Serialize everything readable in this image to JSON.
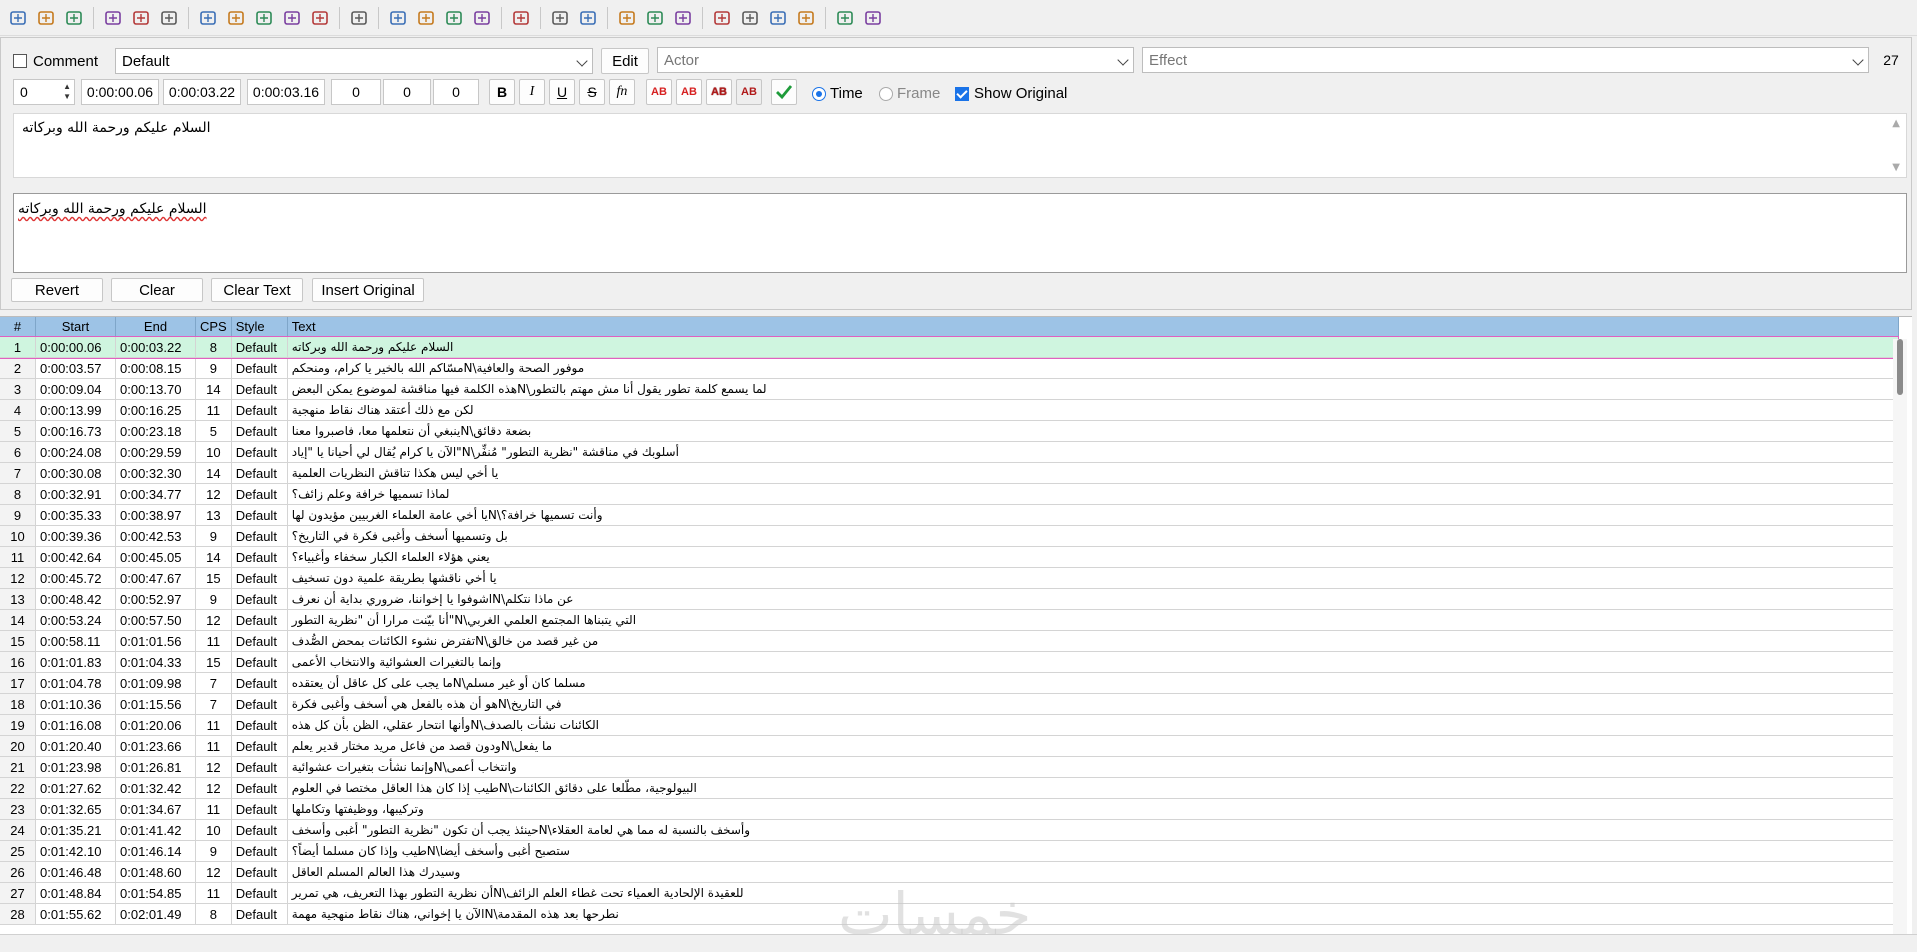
{
  "toolbar": {
    "icons": [
      "new-file-icon",
      "open-folder-icon",
      "save-icon",
      "jump-to-icon",
      "zoom-in-icon",
      "zoom-out-icon",
      "snap-start-icon",
      "snap-end-icon",
      "video-zoom-icon",
      "video-fit-icon",
      "video-full-icon",
      "video-detach-icon",
      "grid-icon",
      "keyframes-icon",
      "styles-manager-icon",
      "attachments-icon",
      "fonts-collector-icon",
      "translation-icon",
      "resample-icon",
      "timing-postprocessor-icon",
      "kanji-timer-icon",
      "shift-times-icon",
      "clock-icon",
      "select-lines-icon",
      "spell-check-icon",
      "automation-icon",
      "tools-icon",
      "options-icon"
    ]
  },
  "edit": {
    "comment_label": "Comment",
    "style_value": "Default",
    "edit_button": "Edit",
    "actor_placeholder": "Actor",
    "effect_placeholder": "Effect",
    "char_count": "27",
    "layer_value": "0",
    "start_time": "0:00:00.06",
    "end_time": "0:00:03.22",
    "duration": "0:00:03.16",
    "margin_l": "0",
    "margin_r": "0",
    "margin_v": "0",
    "bold_label": "B",
    "italic_label": "I",
    "underline_label": "U",
    "strike_label": "S",
    "font_label": "fn",
    "color_labels": [
      "AB",
      "AB",
      "AB",
      "AB"
    ],
    "time_label": "Time",
    "frame_label": "Frame",
    "show_original_label": "Show Original",
    "original_text": "السلام عليكم ورحمة الله وبركاته",
    "edited_text": "السلام عليكم ورحمة الله وبركاته",
    "revert_button": "Revert",
    "clear_button": "Clear",
    "clear_text_button": "Clear Text",
    "insert_original_button": "Insert Original"
  },
  "grid": {
    "headers": [
      "#",
      "Start",
      "End",
      "CPS",
      "Style",
      "Text"
    ],
    "rows": [
      {
        "n": "1",
        "start": "0:00:00.06",
        "end": "0:00:03.22",
        "cps": "8",
        "style": "Default",
        "text": "السلام عليكم ورحمة الله وبركاته"
      },
      {
        "n": "2",
        "start": "0:00:03.57",
        "end": "0:00:08.15",
        "cps": "9",
        "style": "Default",
        "text": "موفور الصحة والعافية\\Nمسّاكم الله بالخير يا كرام، ومنحكم"
      },
      {
        "n": "3",
        "start": "0:00:09.04",
        "end": "0:00:13.70",
        "cps": "14",
        "style": "Default",
        "text": "لما يسمع كلمة تطور يقول أنا مش مهتم بالتطور\\Nهذه الكلمة فيها مناقشة لموضوع يمكن البعض"
      },
      {
        "n": "4",
        "start": "0:00:13.99",
        "end": "0:00:16.25",
        "cps": "11",
        "style": "Default",
        "text": "لكن مع ذلك أعتقد هناك نقاط منهجية"
      },
      {
        "n": "5",
        "start": "0:00:16.73",
        "end": "0:00:23.18",
        "cps": "5",
        "style": "Default",
        "text": "بضعة دقائق\\Nينبغي أن نتعلمها معا، فاصبروا معنا"
      },
      {
        "n": "6",
        "start": "0:00:24.08",
        "end": "0:00:29.59",
        "cps": "10",
        "style": "Default",
        "text": "أسلوبك في مناقشة \"نظرية التطور\" مُنفِّر\\N\"الآن يا كرام يُقال لي أحيانا يا \"إياد"
      },
      {
        "n": "7",
        "start": "0:00:30.08",
        "end": "0:00:32.30",
        "cps": "14",
        "style": "Default",
        "text": "يا أخي ليس هكذا تناقش النظريات العلمية"
      },
      {
        "n": "8",
        "start": "0:00:32.91",
        "end": "0:00:34.77",
        "cps": "12",
        "style": "Default",
        "text": "لماذا تسميها خرافة وعلم زائف؟"
      },
      {
        "n": "9",
        "start": "0:00:35.33",
        "end": "0:00:38.97",
        "cps": "13",
        "style": "Default",
        "text": "وأنت تسميها خرافة؟\\Nيا أخي عامة العلماء الغربيين مؤيدون لها"
      },
      {
        "n": "10",
        "start": "0:00:39.36",
        "end": "0:00:42.53",
        "cps": "9",
        "style": "Default",
        "text": "بل وتسميها أسخف وأغبى فكرة في التاريخ؟"
      },
      {
        "n": "11",
        "start": "0:00:42.64",
        "end": "0:00:45.05",
        "cps": "14",
        "style": "Default",
        "text": "يعني هؤلاء العلماء الكبار سخفاء وأغبياء؟"
      },
      {
        "n": "12",
        "start": "0:00:45.72",
        "end": "0:00:47.67",
        "cps": "15",
        "style": "Default",
        "text": "يا أخي ناقشها بطريقة علمية دون تسخيف"
      },
      {
        "n": "13",
        "start": "0:00:48.42",
        "end": "0:00:52.97",
        "cps": "9",
        "style": "Default",
        "text": "عن ماذا نتكلم\\Nاشوفوا يا إخواننا، ضروري بداية أن نعرف"
      },
      {
        "n": "14",
        "start": "0:00:53.24",
        "end": "0:00:57.50",
        "cps": "12",
        "style": "Default",
        "text": "التي يتبناها المجتمع العلمي الغربي\\N\"أنا بيّنت مرارا أن \"نظرية التطور"
      },
      {
        "n": "15",
        "start": "0:00:58.11",
        "end": "0:01:01.56",
        "cps": "11",
        "style": "Default",
        "text": "من غير قصد من خالق\\Nتفترض نشوء الكائنات بمحض الصُّدف"
      },
      {
        "n": "16",
        "start": "0:01:01.83",
        "end": "0:01:04.33",
        "cps": "15",
        "style": "Default",
        "text": "وإنما بالتغيرات العشوائية والانتخاب الأعمى"
      },
      {
        "n": "17",
        "start": "0:01:04.78",
        "end": "0:01:09.98",
        "cps": "7",
        "style": "Default",
        "text": "مسلما كان أو غير مسلم\\Nما يجب على كل عاقل أن يعتقده"
      },
      {
        "n": "18",
        "start": "0:01:10.36",
        "end": "0:01:15.56",
        "cps": "7",
        "style": "Default",
        "text": "في التاريخ\\Nهو أن هذه بالفعل هي أسخف وأغبى فكرة"
      },
      {
        "n": "19",
        "start": "0:01:16.08",
        "end": "0:01:20.06",
        "cps": "11",
        "style": "Default",
        "text": "الكائنات نشأت بالصدف\\Nوأنها انتحار عقلي، الظن بأن كل هذه"
      },
      {
        "n": "20",
        "start": "0:01:20.40",
        "end": "0:01:23.66",
        "cps": "11",
        "style": "Default",
        "text": "ما يفعل\\Nودون قصد من فاعل مريد مختار قدير يعلم"
      },
      {
        "n": "21",
        "start": "0:01:23.98",
        "end": "0:01:26.81",
        "cps": "12",
        "style": "Default",
        "text": "وانتخاب أعمى\\Nوإنما نشأت بتغيرات عشوائية"
      },
      {
        "n": "22",
        "start": "0:01:27.62",
        "end": "0:01:32.42",
        "cps": "12",
        "style": "Default",
        "text": "البيولوجية، مطّلعا على دقائق الكائنات\\Nطيب إذا كان هذا العاقل مختصا في العلوم"
      },
      {
        "n": "23",
        "start": "0:01:32.65",
        "end": "0:01:34.67",
        "cps": "11",
        "style": "Default",
        "text": "وتركيبها، ووظيفتها وتكاملها"
      },
      {
        "n": "24",
        "start": "0:01:35.21",
        "end": "0:01:41.42",
        "cps": "10",
        "style": "Default",
        "text": "وأسخف بالنسبة له مما هي لعامة العقلاء\\Nحينئذ يجب أن تكون \"نظرية التطور\" أغبى وأسخف"
      },
      {
        "n": "25",
        "start": "0:01:42.10",
        "end": "0:01:46.14",
        "cps": "9",
        "style": "Default",
        "text": "ستصبح أغبى وأسخف أيضا\\Nطيب وإذا كان مسلما أيضاً؟"
      },
      {
        "n": "26",
        "start": "0:01:46.48",
        "end": "0:01:48.60",
        "cps": "12",
        "style": "Default",
        "text": "وسيدرك هذا العالم المسلم العاقل"
      },
      {
        "n": "27",
        "start": "0:01:48.84",
        "end": "0:01:54.85",
        "cps": "11",
        "style": "Default",
        "text": "للعقيدة الإلحادية العمياء تحت غطاء العلم الزائف\\Nأن نظرية التطور بهذا التعريف، هي تمرير"
      },
      {
        "n": "28",
        "start": "0:01:55.62",
        "end": "0:02:01.49",
        "cps": "8",
        "style": "Default",
        "text": "نطرحها بعد هذه المقدمة\\Nالآن يا إخواني، هناك نقاط منهجية مهمة"
      }
    ]
  },
  "watermark": "خمسات",
  "colors": {
    "header": "#9dc3e6",
    "selected_row": "#cff5df",
    "accent": "#1a73e8"
  }
}
